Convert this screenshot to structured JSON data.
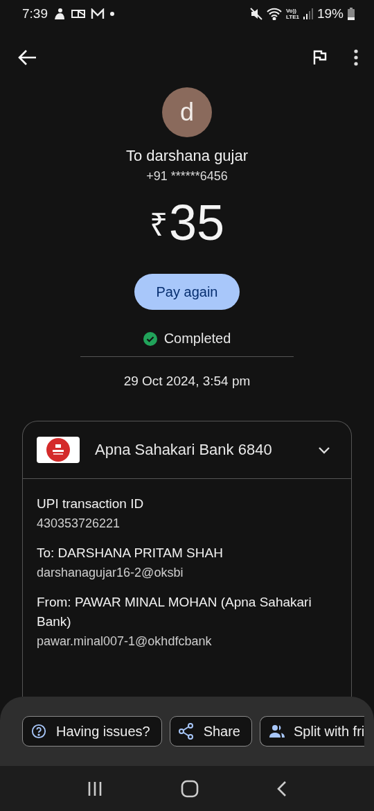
{
  "status_bar": {
    "time": "7:39",
    "network_top": "Vo))",
    "network_bottom": "LTE1",
    "battery": "19%"
  },
  "payee": {
    "initial": "d",
    "name": "To darshana gujar",
    "phone": "+91 ******6456"
  },
  "amount": {
    "currency": "₹",
    "value": "35"
  },
  "pay_again": "Pay again",
  "status": {
    "label": "Completed",
    "kind": "success"
  },
  "date": "29 Oct 2024, 3:54 pm",
  "card": {
    "bank": "Apna Sahakari Bank 6840",
    "expanded": true,
    "details": [
      {
        "label": "UPI transaction ID",
        "value": "430353726221"
      },
      {
        "label": "To: DARSHANA PRITAM SHAH",
        "value": "darshanagujar16-2@oksbi"
      },
      {
        "label": "From: PAWAR MINAL MOHAN (Apna Sahakari Bank)",
        "value": "pawar.minal007-1@okhdfcbank"
      }
    ]
  },
  "actions": [
    {
      "label": "Having issues?",
      "kind": "help"
    },
    {
      "label": "Share",
      "kind": "share"
    },
    {
      "label": "Split with fri",
      "kind": "split"
    }
  ]
}
